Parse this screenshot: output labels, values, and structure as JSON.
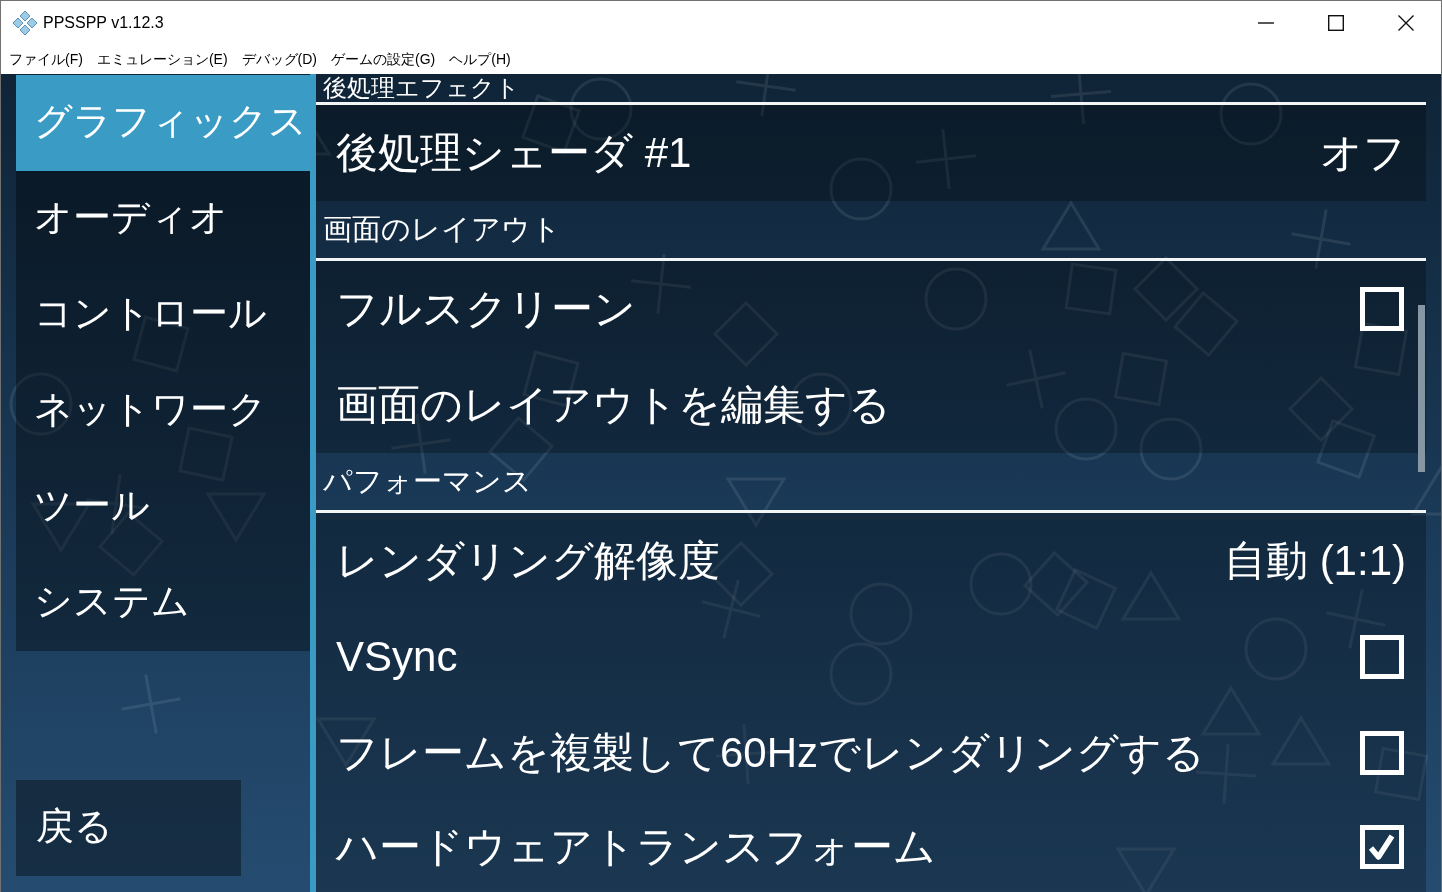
{
  "window": {
    "title": "PPSSPP v1.12.3"
  },
  "menu_bar": [
    "ファイル(F)",
    "エミュレーション(E)",
    "デバッグ(D)",
    "ゲームの設定(G)",
    "ヘルプ(H)"
  ],
  "sidebar": {
    "tabs": [
      {
        "label": "グラフィックス",
        "selected": true
      },
      {
        "label": "オーディオ",
        "selected": false
      },
      {
        "label": "コントロール",
        "selected": false
      },
      {
        "label": "ネットワーク",
        "selected": false
      },
      {
        "label": "ツール",
        "selected": false
      },
      {
        "label": "システム",
        "selected": false
      }
    ],
    "back_button": "戻る"
  },
  "settings": {
    "sections": [
      {
        "header": "後処理エフェクト",
        "items": [
          {
            "kind": "choice",
            "label": "後処理シェーダ #1",
            "value": "オフ"
          }
        ]
      },
      {
        "header": "画面のレイアウト",
        "items": [
          {
            "kind": "checkbox",
            "label": "フルスクリーン",
            "checked": false
          },
          {
            "kind": "action",
            "label": "画面のレイアウトを編集する"
          }
        ]
      },
      {
        "header": "パフォーマンス",
        "items": [
          {
            "kind": "choice",
            "label": "レンダリング解像度",
            "value": "自動 (1:1)"
          },
          {
            "kind": "checkbox",
            "label": "VSync",
            "checked": false
          },
          {
            "kind": "checkbox",
            "label": "フレームを複製して60Hzでレンダリングする",
            "checked": false
          },
          {
            "kind": "checkbox",
            "label": "ハードウェアトランスフォーム",
            "checked": true
          }
        ]
      }
    ]
  }
}
